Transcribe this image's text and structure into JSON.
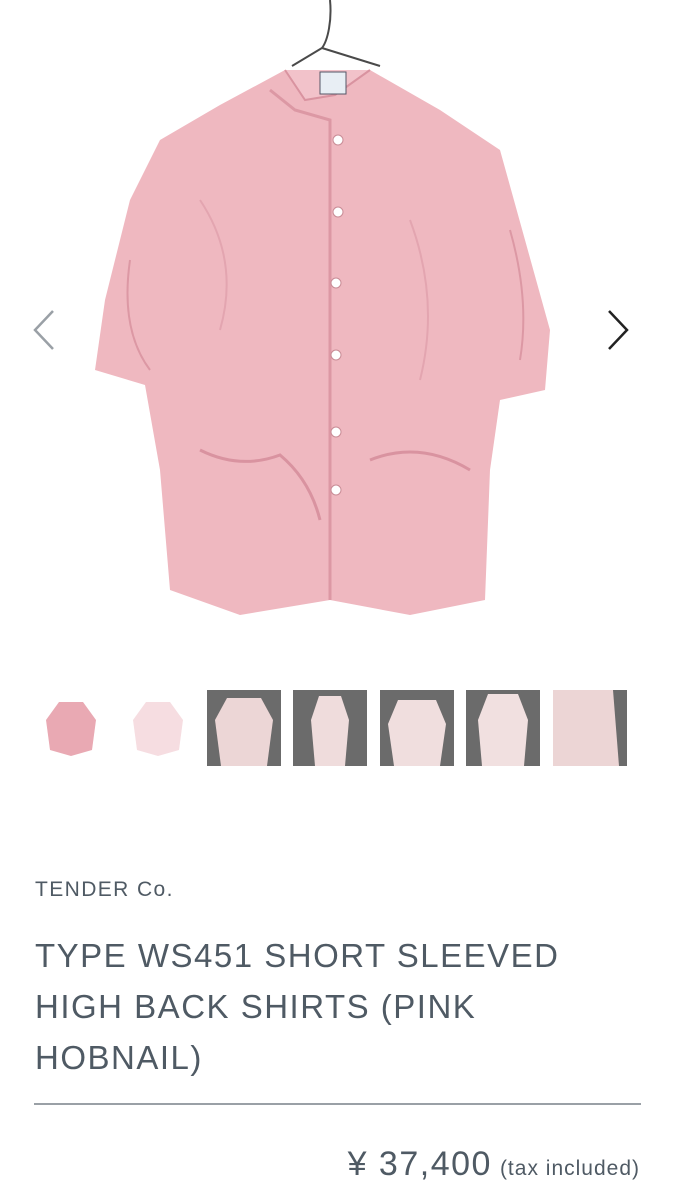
{
  "gallery": {
    "main_image": "pink-hobnail-short-sleeve-shirt-on-hanger",
    "prev_icon": "chevron-left-icon",
    "next_icon": "chevron-right-icon",
    "thumbnail_count": 7,
    "colors": {
      "shirt_pink": "#efb8c0",
      "shirt_shadow": "#dc98a4",
      "thumb_bg": "#6b6b6b",
      "arrow_prev": "#9aa0a6",
      "arrow_next": "#222222"
    }
  },
  "product": {
    "brand": "TENDER Co.",
    "title": "TYPE WS451 SHORT SLEEVED HIGH BACK SHIRTS (PINK HOBNAIL)",
    "price": "¥ 37,400",
    "tax_note": "(tax included)"
  },
  "colors": {
    "text": "#4f5a64",
    "divider": "#9aa0a6",
    "background": "#ffffff"
  }
}
